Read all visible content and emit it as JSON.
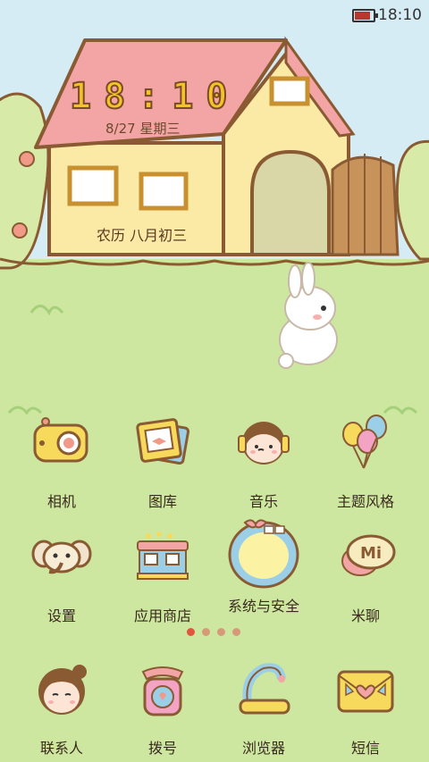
{
  "status_bar": {
    "time": "18:10",
    "battery_level": 0.85
  },
  "widget": {
    "clock": "18:10",
    "date": "8/27  星期三",
    "lunar": "农历 八月初三"
  },
  "apps_row1": [
    {
      "label": "相机",
      "icon": "camera-icon"
    },
    {
      "label": "图库",
      "icon": "gallery-icon"
    },
    {
      "label": "音乐",
      "icon": "music-girl-icon"
    },
    {
      "label": "主题风格",
      "icon": "balloons-icon"
    }
  ],
  "apps_row2": [
    {
      "label": "设置",
      "icon": "elephant-icon"
    },
    {
      "label": "应用商店",
      "icon": "shop-icon"
    },
    {
      "label": "系统与安全",
      "icon": "mirror-icon"
    },
    {
      "label": "米聊",
      "icon": "mi-chat-icon"
    }
  ],
  "dock": [
    {
      "label": "联系人",
      "icon": "girl-face-icon"
    },
    {
      "label": "拨号",
      "icon": "telephone-icon"
    },
    {
      "label": "浏览器",
      "icon": "bathtub-icon"
    },
    {
      "label": "短信",
      "icon": "envelope-icon"
    }
  ],
  "page_indicator": {
    "count": 4,
    "current": 1
  },
  "colors": {
    "sky": "#d6ecf4",
    "grass": "#cde7a0",
    "roof": "#f3a4a4",
    "wall": "#fbe9a6",
    "clock": "#f5c324"
  }
}
